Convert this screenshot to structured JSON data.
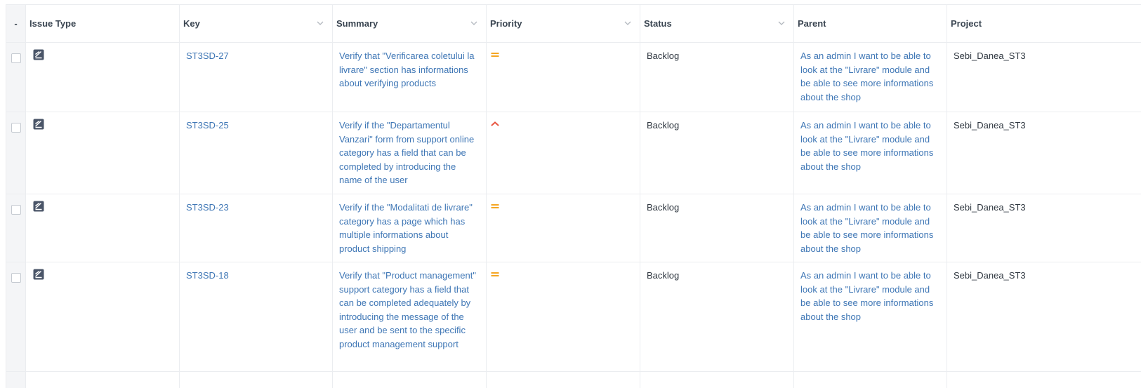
{
  "columns": {
    "select": "-",
    "issue_type": "Issue Type",
    "key": "Key",
    "summary": "Summary",
    "priority": "Priority",
    "status": "Status",
    "parent": "Parent",
    "project": "Project"
  },
  "rows": [
    {
      "issue_type_icon": "test-issue-icon",
      "key": "ST3SD-27",
      "summary": "Verify that \"Verificarea coletului la livrare\" section has informations about verifying products",
      "priority_icon": "medium-priority-icon",
      "status": "Backlog",
      "parent": "As an admin I want to be able to look at the \"Livrare\" module and be able to see more informations about the shop",
      "project": "Sebi_Danea_ST3"
    },
    {
      "issue_type_icon": "test-issue-icon",
      "key": "ST3SD-25",
      "summary": "Verify if the \"Departamentul Vanzari\" form from support online category has a field that can be completed by introducing the name of the user",
      "priority_icon": "high-priority-icon",
      "status": "Backlog",
      "parent": "As an admin I want to be able to look at the \"Livrare\" module and be able to see more informations about the shop",
      "project": "Sebi_Danea_ST3"
    },
    {
      "issue_type_icon": "test-issue-icon",
      "key": "ST3SD-23",
      "summary": "Verify if the \"Modalitati de livrare\" category has a page which has multiple informations about product shipping",
      "priority_icon": "medium-priority-icon",
      "status": "Backlog",
      "parent": "As an admin I want to be able to look at the \"Livrare\" module and be able to see more informations about the shop",
      "project": "Sebi_Danea_ST3"
    },
    {
      "issue_type_icon": "test-issue-icon",
      "key": "ST3SD-18",
      "summary": "Verify that \"Product management\" support category has a field that can be completed adequately by introducing the message of the user and be sent to the specific product management support",
      "priority_icon": "medium-priority-icon",
      "status": "Backlog",
      "parent": "As an admin I want to be able to look at the \"Livrare\" module and be able to see more informations about the shop",
      "project": "Sebi_Danea_ST3"
    }
  ],
  "colors": {
    "link": "#3e76b5",
    "medium_priority": "#f5a623",
    "high_priority": "#e8533f",
    "issue_icon": "#4a5568"
  }
}
